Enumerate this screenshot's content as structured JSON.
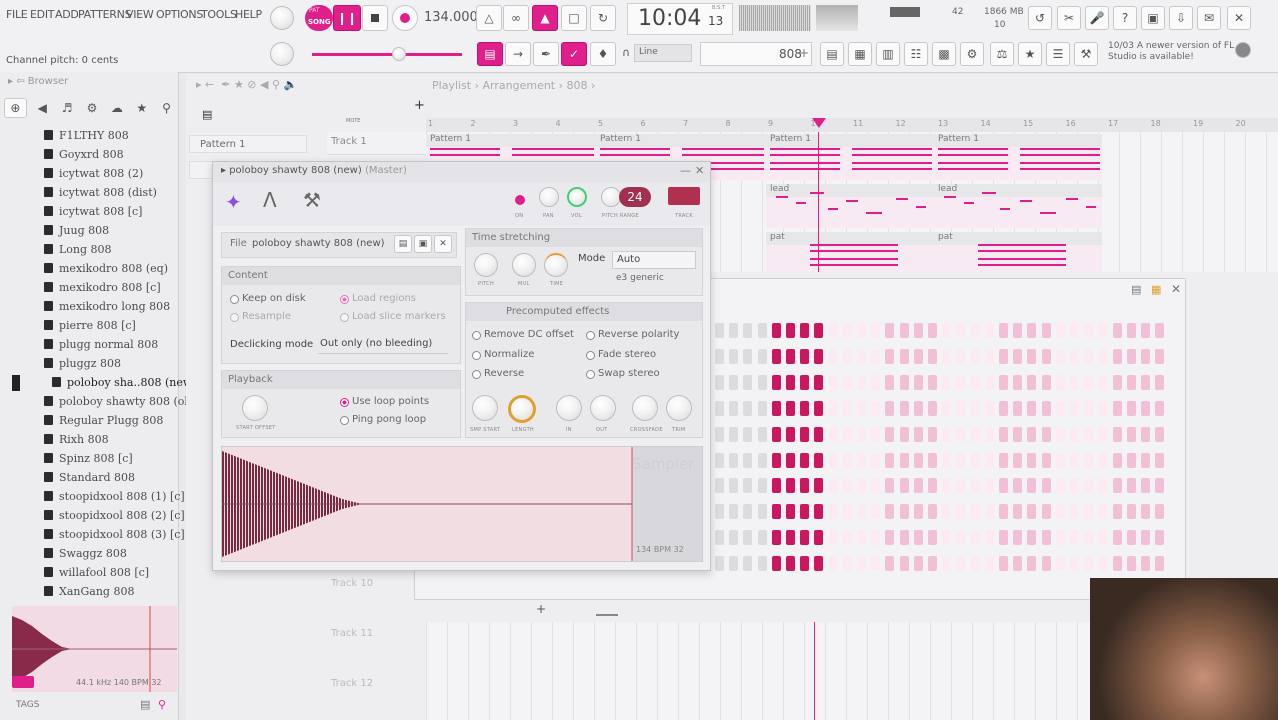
{
  "menu": [
    "FILE",
    "EDIT",
    "ADD",
    "PATTERNS",
    "VIEW",
    "OPTIONS",
    "TOOLS",
    "HELP"
  ],
  "transport": {
    "mode": "SONG",
    "mode_small": "PAT",
    "tempo": "134.000",
    "time": "10:04",
    "time_small": "13",
    "bst": "B:S:T"
  },
  "monitor": {
    "cpu": "42",
    "ram": "1866 MB",
    "poly": "10"
  },
  "hint_bar": {
    "text": "Channel pitch: 0 cents"
  },
  "snap": {
    "label": "Line",
    "pattern": "808"
  },
  "news": {
    "time": "10/03",
    "text": "A newer version of FL Studio is available!"
  },
  "browser": {
    "title": "Browser",
    "items": [
      "F1LTHY 808",
      "Goyxrd 808",
      "icytwat 808 (2)",
      "icytwat 808 (dist)",
      "icytwat 808 [c]",
      "Juug 808",
      "Long 808",
      "mexikodro 808 (eq)",
      "mexikodro 808 [c]",
      "mexikodro long 808",
      "pierre 808 [c]",
      "plugg normal 808",
      "pluggz 808",
      "poloboy sha..808 (new)",
      "poloboy shawty 808 (old)",
      "Regular Plugg 808",
      "Rixh 808",
      "Spinz 808 [c]",
      "Standard 808",
      "stoopidxool 808 (1) [c]",
      "stoopidxool 808 (2) [c]",
      "stoopidxool 808 (3) [c]",
      "Swaggz 808",
      "willafool 808 [c]",
      "XanGang 808"
    ],
    "preview_info": "44.1 kHz 140 BPM 32",
    "tags": "TAGS"
  },
  "playlist": {
    "breadcrumb": [
      "Playlist",
      "Arrangement",
      "808"
    ],
    "patterns": [
      "Pattern 1",
      "Pattern 1"
    ],
    "tracks": [
      "Track 1",
      "Track 10",
      "Track 11",
      "Track 12"
    ],
    "clip_labels": [
      "Pattern 1",
      "Pattern 1",
      "Pattern 1",
      "Pattern 1",
      "lead",
      "lead",
      "pat",
      "pat"
    ],
    "bar_numbers": [
      "1",
      "2",
      "3",
      "4",
      "5",
      "6",
      "7",
      "8",
      "9",
      "10",
      "11",
      "12",
      "13",
      "14",
      "15",
      "16",
      "17",
      "18",
      "19",
      "20"
    ],
    "tool_label": "MOTE"
  },
  "sampler": {
    "title": "poloboy shawty 808 (new)",
    "title_suffix": "(Master)",
    "file_label": "File",
    "file_name": "poloboy shawty 808 (new).wav",
    "pitch_range": "24",
    "knob_labels": [
      "ON",
      "PAN",
      "VOL",
      "PITCH RANGE",
      "TRACK"
    ],
    "content": {
      "header": "Content",
      "options": [
        "Keep on disk",
        "Load regions",
        "Resample",
        "Load slice markers"
      ],
      "declicking_label": "Declicking mode",
      "declicking_value": "Out only (no bleeding)"
    },
    "playback": {
      "header": "Playback",
      "start_offset": "START OFFSET",
      "options": [
        "Use loop points",
        "Ping pong loop"
      ]
    },
    "time_stretching": {
      "header": "Time stretching",
      "knobs": [
        "PITCH",
        "MUL",
        "TIME"
      ],
      "mode_label": "Mode",
      "mode_value": "Auto",
      "engine": "e3 generic"
    },
    "precomputed": {
      "header": "Precomputed effects",
      "options": [
        "Remove DC offset",
        "Reverse polarity",
        "Normalize",
        "Fade stereo",
        "Reverse",
        "Swap stereo"
      ],
      "knobs": [
        "SMP START",
        "LENGTH",
        "IN",
        "OUT",
        "CROSSFADE",
        "TRIM"
      ]
    },
    "waveform": {
      "watermark": "Sampler",
      "info": "134 BPM 32"
    }
  }
}
